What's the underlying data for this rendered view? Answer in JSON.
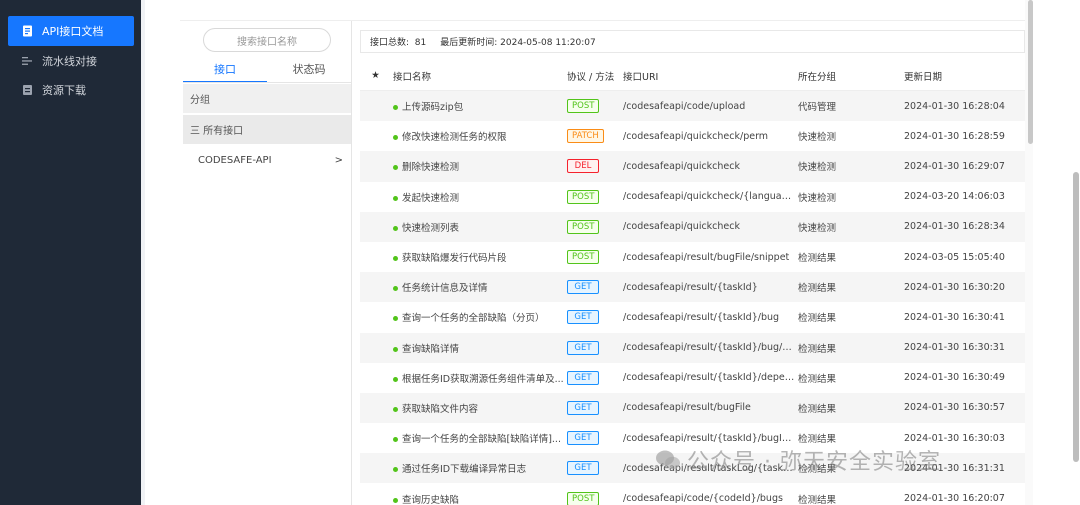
{
  "sidebar": {
    "items": [
      {
        "label": "API接口文档",
        "icon": "document-icon",
        "active": true
      },
      {
        "label": "流水线对接",
        "icon": "pipeline-icon",
        "active": false
      },
      {
        "label": "资源下载",
        "icon": "download-icon",
        "active": false
      }
    ]
  },
  "left_panel": {
    "search_placeholder": "搜索接口名称",
    "tabs": [
      "接口",
      "状态码"
    ],
    "group_label": "分组",
    "all_label": "三 所有接口",
    "api_group": "CODESAFE-API",
    "api_group_arrow": ">"
  },
  "info": {
    "total_label": "接口总数:",
    "total_value": "81",
    "updated_label": "最后更新时间:",
    "updated_value": "2024-05-08 11:20:07"
  },
  "table": {
    "headers": {
      "star": "★",
      "name": "接口名称",
      "method": "协议 / 方法",
      "uri": "接口URI",
      "group": "所在分组",
      "date": "更新日期"
    },
    "rows": [
      {
        "name": "上传源码zip包",
        "method": "POST",
        "uri": "/codesafeapi/code/upload",
        "group": "代码管理",
        "date": "2024-01-30 16:28:04"
      },
      {
        "name": "修改快速检测任务的权限",
        "method": "PATCH",
        "uri": "/codesafeapi/quickcheck/perm",
        "group": "快速检测",
        "date": "2024-01-30 16:28:59"
      },
      {
        "name": "删除快速检测",
        "method": "DEL",
        "uri": "/codesafeapi/quickcheck",
        "group": "快速检测",
        "date": "2024-01-30 16:29:07"
      },
      {
        "name": "发起快速检测",
        "method": "POST",
        "uri": "/codesafeapi/quickcheck/{language}...",
        "group": "快速检测",
        "date": "2024-03-20 14:06:03"
      },
      {
        "name": "快速检测列表",
        "method": "POST",
        "uri": "/codesafeapi/quickcheck",
        "group": "快速检测",
        "date": "2024-01-30 16:28:34"
      },
      {
        "name": "获取缺陷爆发行代码片段",
        "method": "POST",
        "uri": "/codesafeapi/result/bugFile/snippet",
        "group": "检测结果",
        "date": "2024-03-05 15:05:40"
      },
      {
        "name": "任务统计信息及详情",
        "method": "GET",
        "uri": "/codesafeapi/result/{taskId}",
        "group": "检测结果",
        "date": "2024-01-30 16:30:20"
      },
      {
        "name": "查询一个任务的全部缺陷（分页）",
        "method": "GET",
        "uri": "/codesafeapi/result/{taskId}/bug",
        "group": "检测结果",
        "date": "2024-01-30 16:30:41"
      },
      {
        "name": "查询缺陷详情",
        "method": "GET",
        "uri": "/codesafeapi/result/{taskId}/bug/{bu...",
        "group": "检测结果",
        "date": "2024-01-30 16:30:31"
      },
      {
        "name": "根据任务ID获取溯源任务组件清单及...",
        "method": "GET",
        "uri": "/codesafeapi/result/{taskId}/depend...",
        "group": "检测结果",
        "date": "2024-01-30 16:30:49"
      },
      {
        "name": "获取缺陷文件内容",
        "method": "GET",
        "uri": "/codesafeapi/result/bugFile",
        "group": "检测结果",
        "date": "2024-01-30 16:30:57"
      },
      {
        "name": "查询一个任务的全部缺陷[缺陷详情]...",
        "method": "GET",
        "uri": "/codesafeapi/result/{taskId}/bugInfos",
        "group": "检测结果",
        "date": "2024-01-30 16:30:03"
      },
      {
        "name": "通过任务ID下载编译异常日志",
        "method": "GET",
        "uri": "/codesafeapi/result/taskLog/{taskId}",
        "group": "检测结果",
        "date": "2024-01-30 16:31:31"
      },
      {
        "name": "查询历史缺陷",
        "method": "POST",
        "uri": "/codesafeapi/code/{codeId}/bugs",
        "group": "检测结果",
        "date": "2024-01-30 16:20:07"
      }
    ]
  },
  "watermark": "公众号 · 弥天安全实验室",
  "colors": {
    "sidebar_bg": "#1f2937",
    "accent": "#1677ff",
    "post": "#52c41a",
    "get": "#1890ff",
    "patch": "#fa8c16",
    "del": "#f5222d"
  }
}
